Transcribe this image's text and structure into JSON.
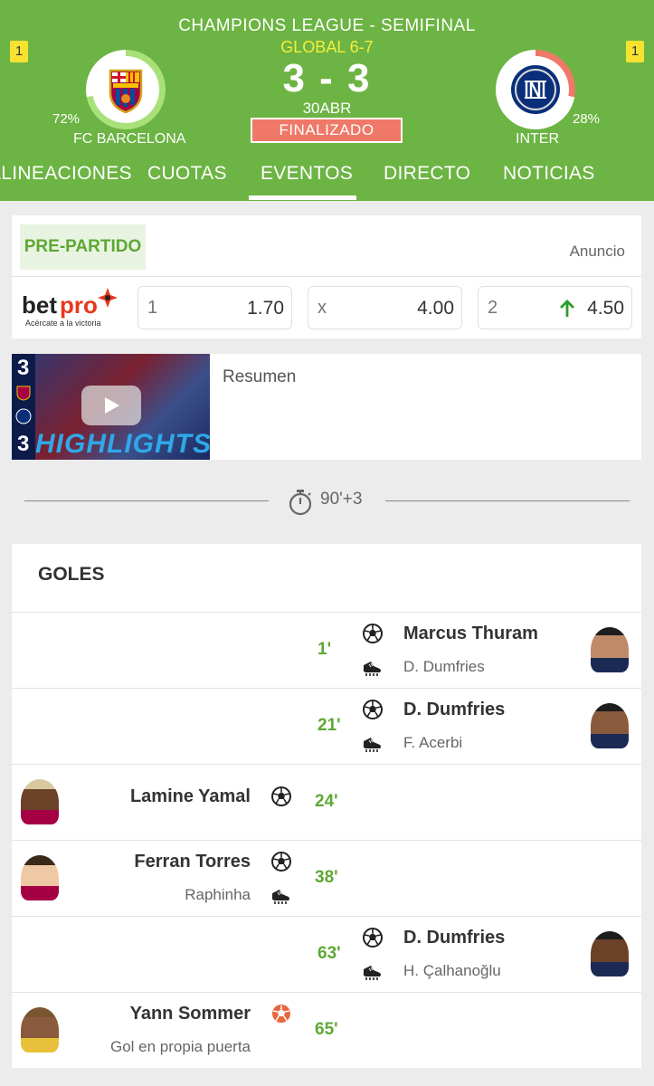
{
  "header": {
    "competition": "CHAMPIONS LEAGUE - SEMIFINAL",
    "aggregate": "GLOBAL 6-7",
    "score": "3 - 3",
    "date": "30ABR",
    "status": "FINALIZADO",
    "home": {
      "name": "FC BARCELONA",
      "pct": "72%",
      "badge": "1",
      "ring_fraction": 0.72
    },
    "away": {
      "name": "INTER",
      "pct": "28%",
      "badge": "1",
      "ring_fraction": 0.28
    },
    "colors": {
      "green": "#6cb443",
      "yellow": "#f7e32f",
      "status_red": "#ef7868",
      "ring_light": "#a8e07a",
      "ring_red": "#ef7868"
    }
  },
  "tabs": [
    {
      "label": "ALINEACIONES"
    },
    {
      "label": "CUOTAS"
    },
    {
      "label": "EVENTOS",
      "active": true
    },
    {
      "label": "DIRECTO"
    },
    {
      "label": "NOTICIAS"
    }
  ],
  "odds": {
    "section_label": "PRE-PARTIDO",
    "ad_label": "Anuncio",
    "bookmaker": {
      "name_a": "bet",
      "name_b": "pro",
      "tagline": "Acércate a la victoria"
    },
    "options": [
      {
        "label": "1",
        "value": "1.70"
      },
      {
        "label": "x",
        "value": "4.00"
      },
      {
        "label": "2",
        "value": "4.50",
        "trend": "up"
      }
    ]
  },
  "highlights": {
    "title": "Resumen",
    "thumb_text": "HIGHLIGHTS",
    "score_home": "3",
    "score_away": "3"
  },
  "time_marker": "90'+3",
  "goals": {
    "title": "GOLES",
    "events": [
      {
        "side": "away",
        "minute": "1'",
        "scorer": "Marcus Thuram",
        "assist": "D. Dumfries",
        "type": "goal"
      },
      {
        "side": "away",
        "minute": "21'",
        "scorer": "D. Dumfries",
        "assist": "F. Acerbi",
        "type": "goal"
      },
      {
        "side": "home",
        "minute": "24'",
        "scorer": "Lamine Yamal",
        "assist": "",
        "type": "goal"
      },
      {
        "side": "home",
        "minute": "38'",
        "scorer": "Ferran Torres",
        "assist": "Raphinha",
        "type": "goal"
      },
      {
        "side": "away",
        "minute": "63'",
        "scorer": "D. Dumfries",
        "assist": "H. Çalhanoğlu",
        "type": "goal"
      },
      {
        "side": "home",
        "minute": "65'",
        "scorer": "Yann Sommer",
        "assist": "Gol en propia puerta",
        "type": "own-goal"
      }
    ]
  }
}
